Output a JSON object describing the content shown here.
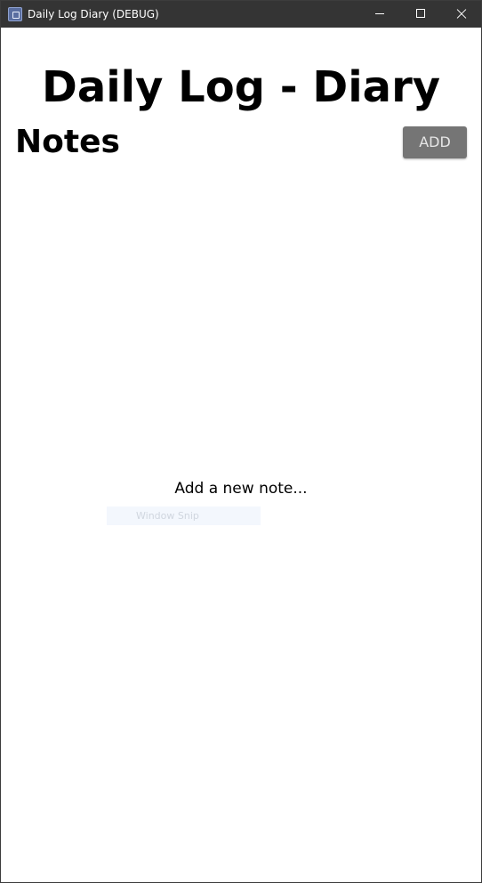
{
  "window": {
    "title": "Daily Log Diary (DEBUG)",
    "icons": {
      "app": "app-icon",
      "minimize": "minimize-icon",
      "maximize": "maximize-icon",
      "close": "close-icon"
    }
  },
  "header": {
    "app_title": "Daily Log - Diary"
  },
  "notes": {
    "section_title": "Notes",
    "add_label": "ADD",
    "empty_hint": "Add a new note..."
  },
  "overlay": {
    "snip_label": "Window Snip"
  },
  "colors": {
    "titlebar": "#343434",
    "button": "#757575",
    "button_text": "#e6e6e6",
    "text": "#000000",
    "background": "#ffffff"
  }
}
